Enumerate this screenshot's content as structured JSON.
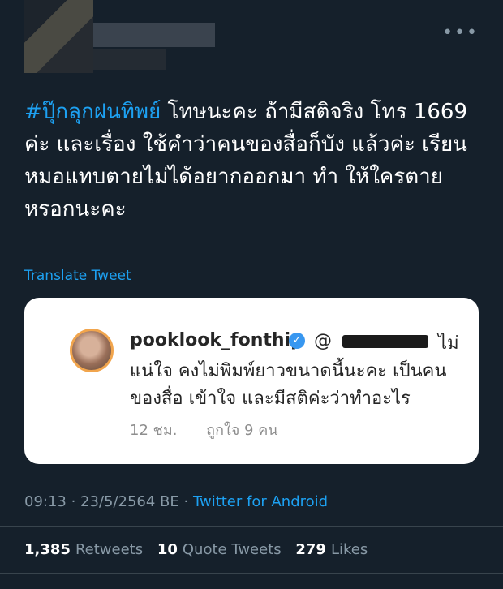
{
  "tweet": {
    "hashtag": "#ปุ๊กลุกฝนทิพย์",
    "text": " โทษนะคะ ถ้ามีสติจริง โทร 1669 ค่ะ และเรื่อง ใช้คำว่าคนของสื่อก็บัง แล้วค่ะ เรียนหมอแทบตายไม่ได้อยากออกมา ทำ ให้ใครตายหรอกนะคะ",
    "translate_label": "Translate Tweet",
    "timestamp": "09:13 · 23/5/2564 BE · ",
    "source": "Twitter for Android"
  },
  "embed": {
    "username": "pooklook_fonthip",
    "mention": "@",
    "body": "ไม่ แน่ใจ คงไม่พิมพ์ยาวขนาดนี้นะคะ เป็นคน ของสื่อ เข้าใจ และมีสติค่ะว่าทำอะไร",
    "age": "12 ชม.",
    "likes": "ถูกใจ 9 คน"
  },
  "stats": {
    "retweets_count": "1,385",
    "retweets_label": "Retweets",
    "quotes_count": "10",
    "quotes_label": "Quote Tweets",
    "likes_count": "279",
    "likes_label": "Likes"
  },
  "header": {
    "more_icon": "more-horizontal-icon"
  }
}
